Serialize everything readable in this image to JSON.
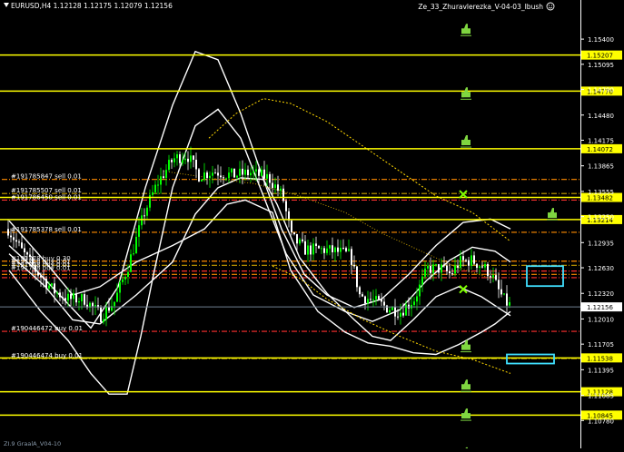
{
  "header": {
    "symbol_info": "EURUSD,H4  1.12128 1.12175 1.12079 1.12156",
    "indicator_title": "Ze_33_Zhuravlerezka_V-04-03_Ibush",
    "smiley_icon": "smiley-face-icon"
  },
  "footer": {
    "indicator_label": "ZI.9 GraalA_V04-10"
  },
  "colors": {
    "background": "#000000",
    "bull_candle": "#00ff00",
    "bear_candle": "#ffffff",
    "level_line": "#ffff00",
    "price_badge": "#ffff00",
    "bid_line": "#708090",
    "band": "#ffffff",
    "ma_dotted": "#ffd700",
    "order_text": "#ffffff",
    "dashdot_orange": "#ff8c00",
    "dashdot_red": "#ff3030",
    "dashdot_yellow": "#c8a000",
    "thumb_icon": "#7fd640",
    "cross_icon": "#7fff00",
    "rect_outline": "#40e0ff"
  },
  "price_axis": {
    "top_price": 1.1572,
    "bottom_price": 1.1075,
    "ticks": [
      "1.15400",
      "1.15095",
      "1.14790",
      "1.14480",
      "1.14175",
      "1.13865",
      "1.13555",
      "1.13250",
      "1.12935",
      "1.12630",
      "1.12320",
      "1.12010",
      "1.11705",
      "1.11395",
      "1.11085",
      "1.10780"
    ],
    "current_price": "1.12156"
  },
  "levels": [
    {
      "price": 1.15207,
      "label": "1.15207"
    },
    {
      "price": 1.1477,
      "label": "1.14770"
    },
    {
      "price": 1.14072,
      "label": "1.14072"
    },
    {
      "price": 1.13482,
      "label": "1.13482"
    },
    {
      "price": 1.13214,
      "label": "1.13214"
    },
    {
      "price": 1.11538,
      "label": "1.11538"
    },
    {
      "price": 1.11128,
      "label": "1.11128"
    },
    {
      "price": 1.10845,
      "label": "1.10845"
    }
  ],
  "orders": [
    {
      "label": "#191785847 sell 0.01",
      "price": 1.137
    },
    {
      "label": "#191785507 sell 0.01",
      "price": 1.1353
    },
    {
      "label": "#191786450 sell 0.01",
      "price": 1.1345
    },
    {
      "label": "#191785378 sell 0.01",
      "price": 1.1306
    },
    {
      "label": "#190446472 buy 0.01",
      "price": 1.1186
    },
    {
      "label": "#190446474 buy 0.01",
      "price": 1.1153
    }
  ],
  "overlapping_order_labels": [
    "#191778 buy 0.30",
    "#191778 buy 0.01",
    "#191778 buy 0.01",
    "#191778 buy 0.01"
  ],
  "order_dashdot_lines": [
    {
      "price": 1.137,
      "color": "#ff8c00"
    },
    {
      "price": 1.1353,
      "color": "#c8a000"
    },
    {
      "price": 1.1345,
      "color": "#ff3030"
    },
    {
      "price": 1.1306,
      "color": "#ff8c00"
    },
    {
      "price": 1.1271,
      "color": "#ff8c00"
    },
    {
      "price": 1.1266,
      "color": "#c8a000"
    },
    {
      "price": 1.1259,
      "color": "#ff3030"
    },
    {
      "price": 1.1255,
      "color": "#ff8c00"
    },
    {
      "price": 1.1251,
      "color": "#ff3030"
    },
    {
      "price": 1.1186,
      "color": "#ff3030"
    },
    {
      "price": 1.1153,
      "color": "#c8a000"
    }
  ],
  "thumb_icons": [
    {
      "index": 0,
      "name": "thumbs-up-icon"
    },
    {
      "index": 1,
      "name": "thumbs-up-icon"
    },
    {
      "index": 2,
      "name": "thumbs-up-icon"
    },
    {
      "index": 3,
      "name": "thumbs-up-icon"
    },
    {
      "index": 4,
      "name": "thumbs-up-icon"
    },
    {
      "index": 5,
      "name": "thumbs-up-icon"
    },
    {
      "index": 6,
      "name": "thumbs-up-icon"
    },
    {
      "index": 7,
      "name": "thumbs-up-icon"
    }
  ]
}
